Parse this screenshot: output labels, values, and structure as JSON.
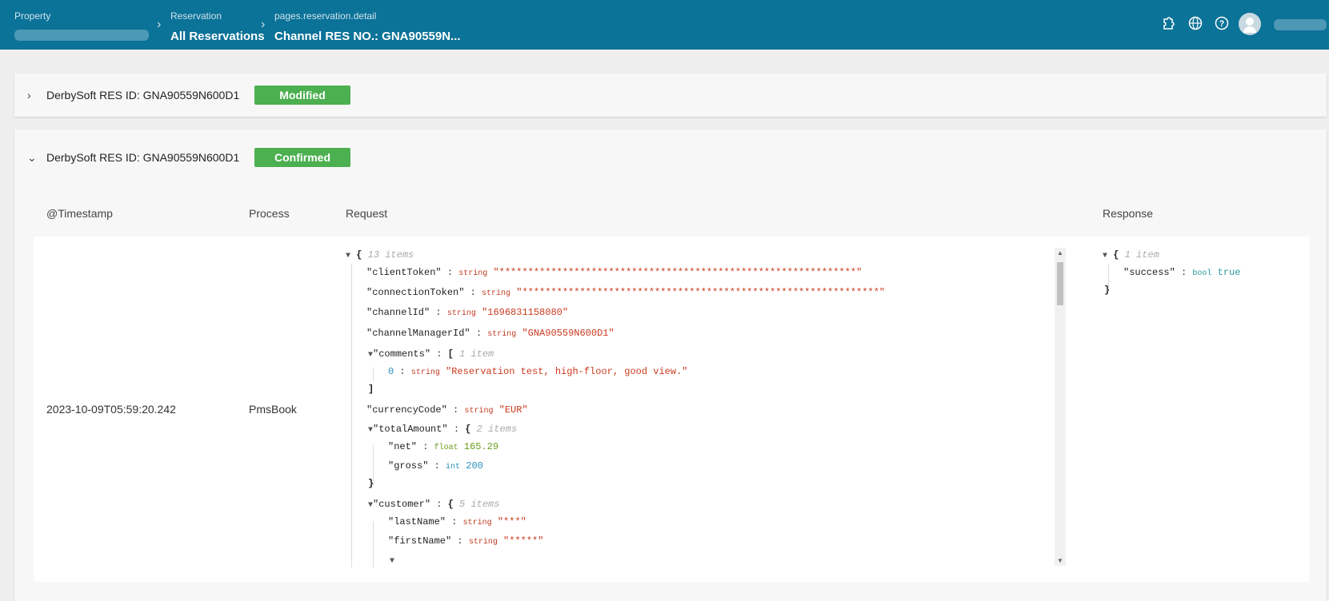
{
  "header": {
    "property_caption": "Property",
    "reservation_caption": "Reservation",
    "reservation_value": "All Reservations",
    "detail_caption": "pages.reservation.detail",
    "detail_value": "Channel RES NO.: GNA90559N..."
  },
  "panels": [
    {
      "chevron": "›",
      "res_id": "DerbySoft RES ID: GNA90559N600D1",
      "status": "Modified"
    },
    {
      "chevron": "⌄",
      "res_id": "DerbySoft RES ID: GNA90559N600D1",
      "status": "Confirmed"
    }
  ],
  "table": {
    "headers": [
      "@Timestamp",
      "Process",
      "Request",
      "Response"
    ],
    "row": {
      "timestamp": "2023-10-09T05:59:20.242",
      "process": "PmsBook"
    }
  },
  "request_json": {
    "root_count": "13 items",
    "clientToken": "\"**************************************************************\"",
    "connectionToken": "\"**************************************************************\"",
    "channelId": "\"1696831158080\"",
    "channelManagerId": "\"GNA90559N600D1\"",
    "comments_count": "1 item",
    "comment_0": "\"Reservation test, high-floor, good view.\"",
    "currencyCode": "\"EUR\"",
    "totalAmount_count": "2 items",
    "net": "165.29",
    "gross": "200",
    "customer_count": "5 items",
    "lastName": "\"***\"",
    "firstName": "\"*****\""
  },
  "response_json": {
    "root_count": "1 item",
    "success": "true"
  },
  "type_labels": {
    "string": "string",
    "float": "float",
    "int": "int",
    "bool": "bool"
  },
  "colors": {
    "header": "#0b7298",
    "badge": "#4caf50",
    "string_value": "#cb3a1f"
  }
}
